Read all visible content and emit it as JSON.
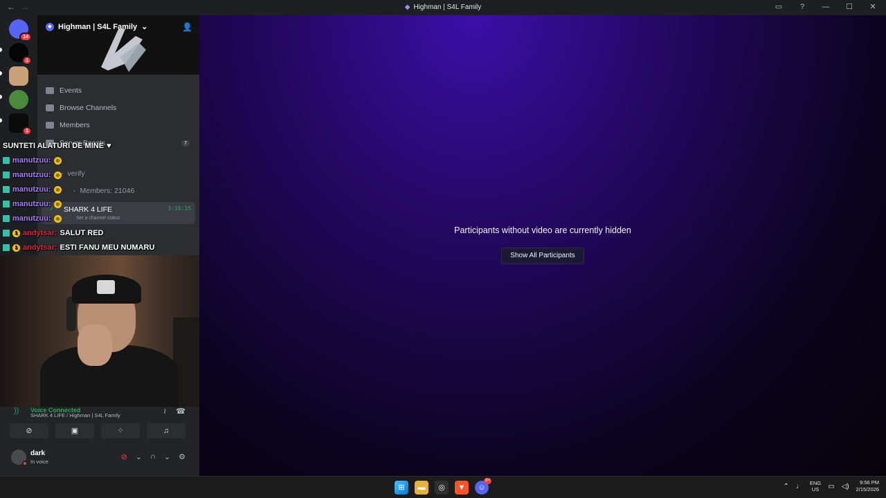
{
  "window": {
    "title": "Highman | S4L Family",
    "back": "←",
    "forward": "→"
  },
  "guilds": [
    {
      "badge": "14"
    },
    {
      "badge": "1"
    },
    {
      "badge": ""
    },
    {
      "badge": ""
    },
    {
      "badge": "1"
    }
  ],
  "server": {
    "name": "Highman | S4L Family",
    "chevron": "⌄",
    "icon_glyph": "◆"
  },
  "menu": {
    "events": "Events",
    "browse": "Browse Channels",
    "members": "Members",
    "server_boosts_partial": "Server Boosts",
    "boost_count": "7"
  },
  "channels": {
    "verify": "verify",
    "members_count": "Members: 21046",
    "active_name": "SHARK 4 LIFE",
    "active_time": "3:38:35",
    "active_status": "Set a channel status"
  },
  "chat_overlay": [
    {
      "user": "",
      "msg": "SUNTETI ALATURI DE MINE",
      "emote": "♥"
    },
    {
      "user": "manutzuu:",
      "msg": "",
      "emote": "😮"
    },
    {
      "user": "manutzuu:",
      "msg": "",
      "emote": "😮"
    },
    {
      "user": "manutzuu:",
      "msg": "",
      "emote": "😮"
    },
    {
      "user": "manutzuu:",
      "msg": "",
      "emote": "😮"
    },
    {
      "user": "manutzuu:",
      "msg": "",
      "emote": "😮"
    },
    {
      "user": "andytsar:",
      "msg": "SALUT RED",
      "emote": ""
    },
    {
      "user": "andytsar:",
      "msg": "ESTI FANU MEU NUMARU",
      "emote": ""
    }
  ],
  "voice": {
    "status": "Voice Connected",
    "location": "SHARK 4 LIFE / Highman | S4L Family"
  },
  "user": {
    "name": "dark",
    "status": "In voice"
  },
  "stage": {
    "message": "Participants without video are currently hidden",
    "button": "Show All Participants"
  },
  "taskbar": {
    "lang_line1": "ENG",
    "lang_line2": "US",
    "time": "9:56 PM",
    "date": "2/15/2026",
    "discord_badge": "9+"
  },
  "colors": {
    "accent": "#5865f2",
    "voice_green": "#23a55a",
    "danger": "#f23f43"
  }
}
